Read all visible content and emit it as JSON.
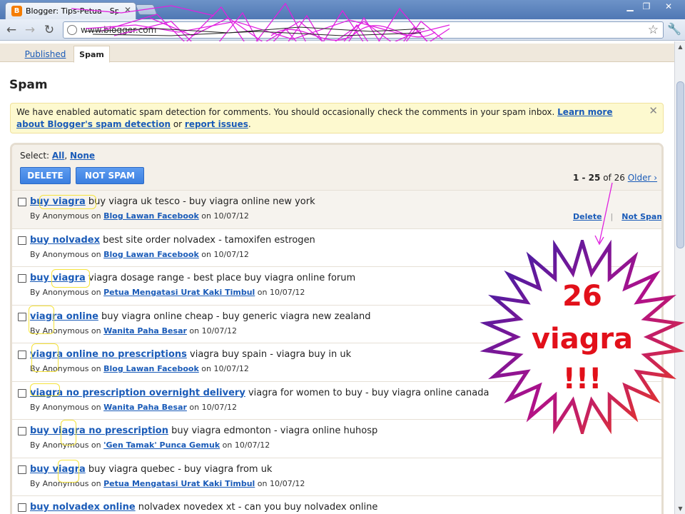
{
  "browser": {
    "tab_favicon": "B",
    "tab_title": "Blogger: Tips-Petua - Spam C",
    "url": "www.blogger.com"
  },
  "page_tabs": {
    "published": "Published",
    "spam": "Spam"
  },
  "page_title": "Spam",
  "notice": {
    "text_before": "We have enabled automatic spam detection for comments. You should occasionally check the comments in your spam inbox. ",
    "link_learn": "Learn more about Blogger's spam detection",
    "text_or": " or ",
    "link_report": "report issues",
    "text_after": "."
  },
  "toolbar": {
    "select_label": "Select: ",
    "all": "All",
    "comma": ", ",
    "none": "None",
    "delete_label": "DELETE",
    "notspam_label": "NOT SPAM"
  },
  "pager": {
    "range": "1 - 25",
    "of": " of ",
    "total": "26",
    "older": "Older ›"
  },
  "row_actions": {
    "delete": "Delete",
    "sep": "|",
    "not_spam": "Not Spam"
  },
  "comments": [
    {
      "subject": "buy viagra",
      "body": " buy viagra uk tesco - buy viagra online new york",
      "by": "By ",
      "author": "Anonymous",
      "on": " on ",
      "blog": "Blog Lawan Facebook",
      "on2": " on ",
      "date": "10/07/12"
    },
    {
      "subject": "buy nolvadex",
      "body": " best site order nolvadex - tamoxifen estrogen",
      "by": "By ",
      "author": "Anonymous",
      "on": " on ",
      "blog": "Blog Lawan Facebook",
      "on2": " on ",
      "date": "10/07/12"
    },
    {
      "subject": "buy viagra",
      "body": " viagra dosage range - best place buy viagra online forum",
      "by": "By ",
      "author": "Anonymous",
      "on": " on ",
      "blog": "Petua Mengatasi Urat Kaki Timbul",
      "on2": " on ",
      "date": "10/07/12"
    },
    {
      "subject": "viagra online",
      "body": " buy viagra online cheap - buy generic viagra new zealand",
      "by": "By ",
      "author": "Anonymous",
      "on": " on ",
      "blog": "Wanita Paha Besar",
      "on2": " on ",
      "date": "10/07/12"
    },
    {
      "subject": "viagra online no prescriptions",
      "body": " viagra buy spain - viagra buy in uk",
      "by": "By ",
      "author": "Anonymous",
      "on": " on ",
      "blog": "Blog Lawan Facebook",
      "on2": " on ",
      "date": "10/07/12"
    },
    {
      "subject": "viagra no prescription overnight delivery",
      "body": " viagra for women to buy - buy viagra online canada",
      "by": "By ",
      "author": "Anonymous",
      "on": " on ",
      "blog": "Wanita Paha Besar",
      "on2": " on ",
      "date": "10/07/12"
    },
    {
      "subject": "buy viagra no prescription",
      "body": " buy viagra edmonton - viagra online huhosp",
      "by": "By ",
      "author": "Anonymous",
      "on": " on ",
      "blog": "'Gen Tamak' Punca Gemuk",
      "on2": " on ",
      "date": "10/07/12"
    },
    {
      "subject": "buy viagra",
      "body": " buy viagra quebec - buy viagra from uk",
      "by": "By ",
      "author": "Anonymous",
      "on": " on ",
      "blog": "Petua Mengatasi Urat Kaki Timbul",
      "on2": " on ",
      "date": "10/07/12"
    },
    {
      "subject": "buy nolvadex online",
      "body": " nolvadex novedex xt - can you buy nolvadex online",
      "by": "By ",
      "author": "Anonymous",
      "on": " on ",
      "blog": "",
      "on2": "",
      "date": ""
    }
  ],
  "annotation": {
    "line1": "26",
    "line2": "viagra",
    "line3": "!!!"
  },
  "colors": {
    "link": "#1a5bb8",
    "button": "#3b7fe0",
    "annotation_text": "#e2101a",
    "scribble": "#e020e0"
  }
}
